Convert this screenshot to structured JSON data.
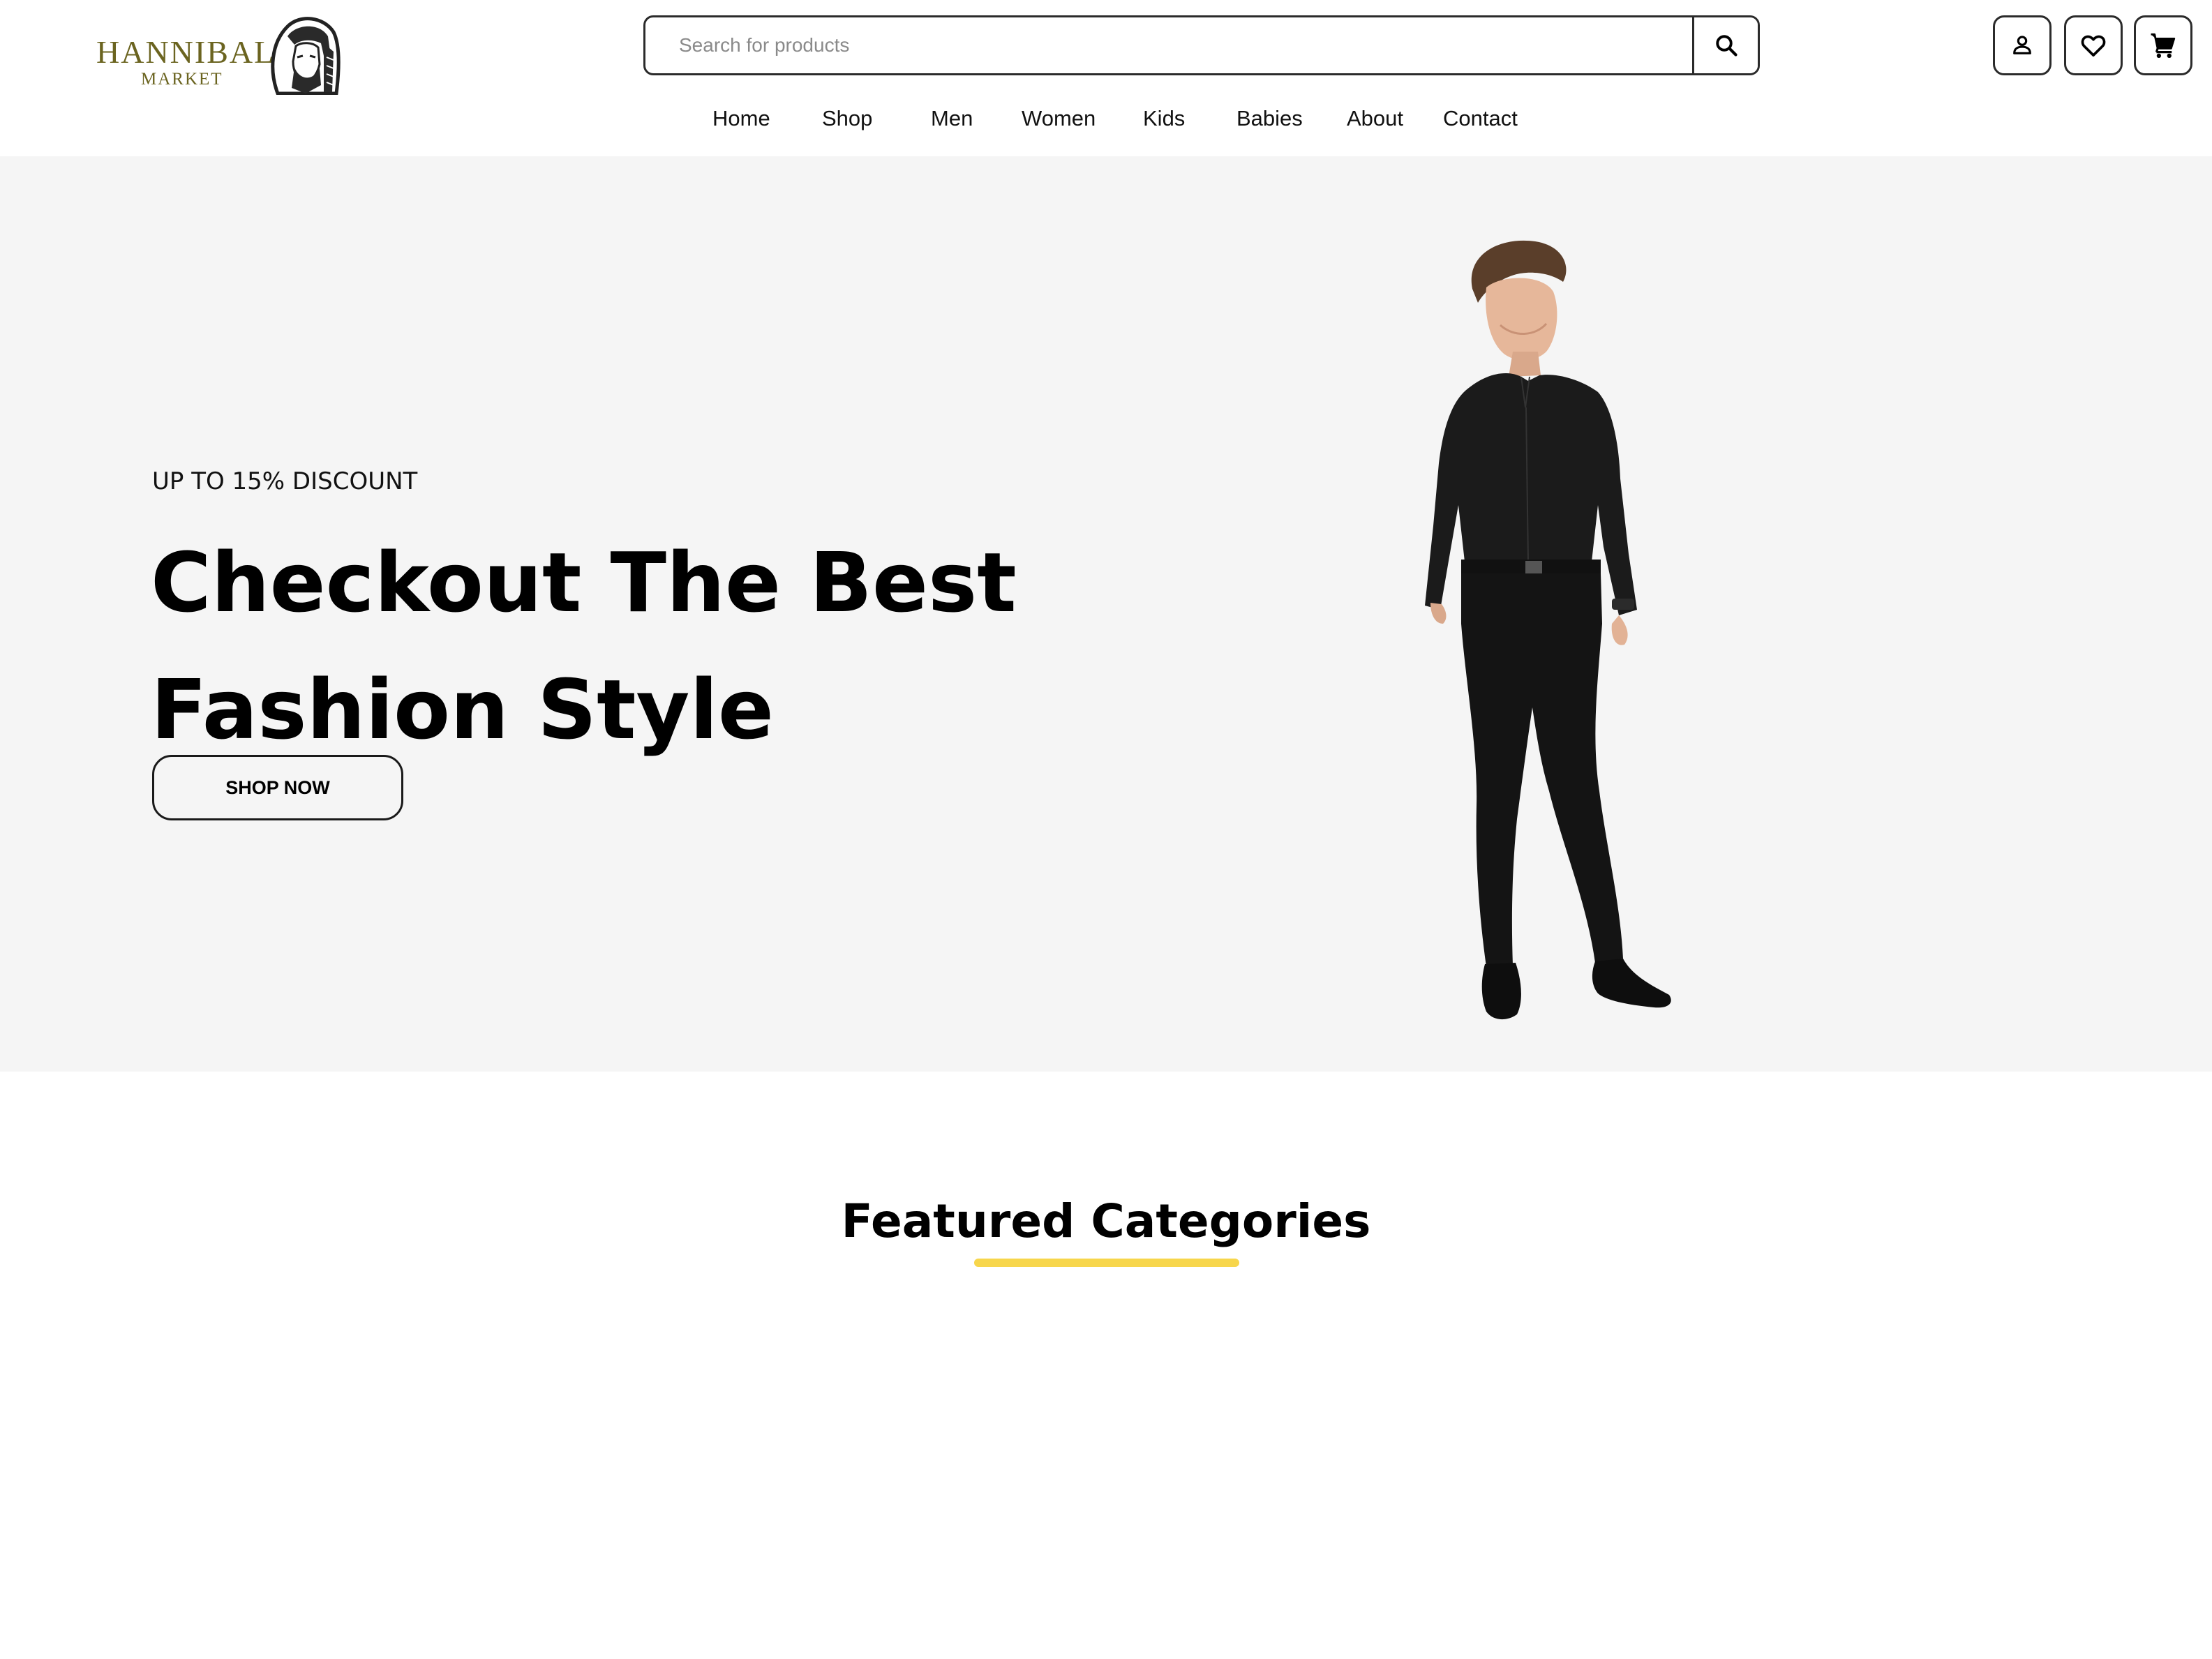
{
  "header": {
    "logo": {
      "name": "HANNIBAL",
      "sub": "MARKET",
      "color": "#6b6420"
    },
    "search": {
      "placeholder": "Search for products",
      "value": ""
    },
    "actions": {
      "account_icon": "user-icon",
      "wishlist_icon": "heart-icon",
      "cart_icon": "cart-icon"
    }
  },
  "nav": {
    "items": [
      {
        "label": "Home"
      },
      {
        "label": "Shop"
      },
      {
        "label": "Men"
      },
      {
        "label": "Women"
      },
      {
        "label": "Kids"
      },
      {
        "label": "Babies"
      },
      {
        "label": "About"
      },
      {
        "label": "Contact"
      }
    ]
  },
  "hero": {
    "eyebrow": "UP TO 15% DISCOUNT",
    "title_line1": "Checkout The Best",
    "title_line2": "Fashion Style",
    "cta": "SHOP NOW",
    "background": "#f5f5f5"
  },
  "featured": {
    "title": "Featured Categories",
    "accent": "#f7d64c"
  }
}
